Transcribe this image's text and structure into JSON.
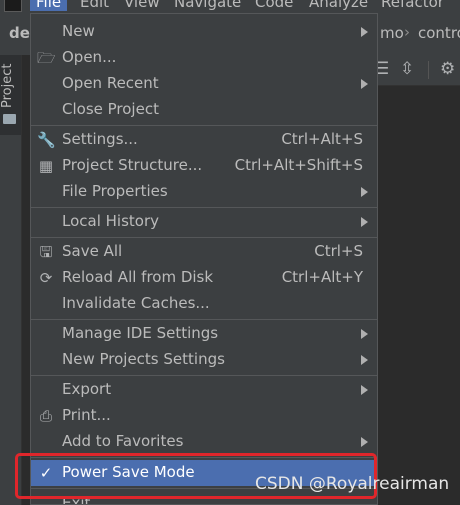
{
  "menubar": {
    "items": [
      "File",
      "Edit",
      "View",
      "Navigate",
      "Code",
      "Analyze",
      "Refactor"
    ]
  },
  "navbar": {
    "project_crumb": "der",
    "crumb_1": "mo",
    "crumb_2": "contro"
  },
  "sidebar": {
    "project_tab": "Project"
  },
  "menu": {
    "new": "New",
    "open": "Open...",
    "open_recent": "Open Recent",
    "close_project": "Close Project",
    "settings": "Settings...",
    "settings_sc": "Ctrl+Alt+S",
    "project_structure": "Project Structure...",
    "project_structure_sc": "Ctrl+Alt+Shift+S",
    "file_properties": "File Properties",
    "local_history": "Local History",
    "save_all": "Save All",
    "save_all_sc": "Ctrl+S",
    "reload": "Reload All from Disk",
    "reload_sc": "Ctrl+Alt+Y",
    "invalidate": "Invalidate Caches...",
    "manage_ide": "Manage IDE Settings",
    "new_projects_settings": "New Projects Settings",
    "export": "Export",
    "print": "Print...",
    "add_favorites": "Add to Favorites",
    "power_save": "Power Save Mode",
    "exit": "Exit"
  },
  "watermark": "CSDN @Royalreairman"
}
